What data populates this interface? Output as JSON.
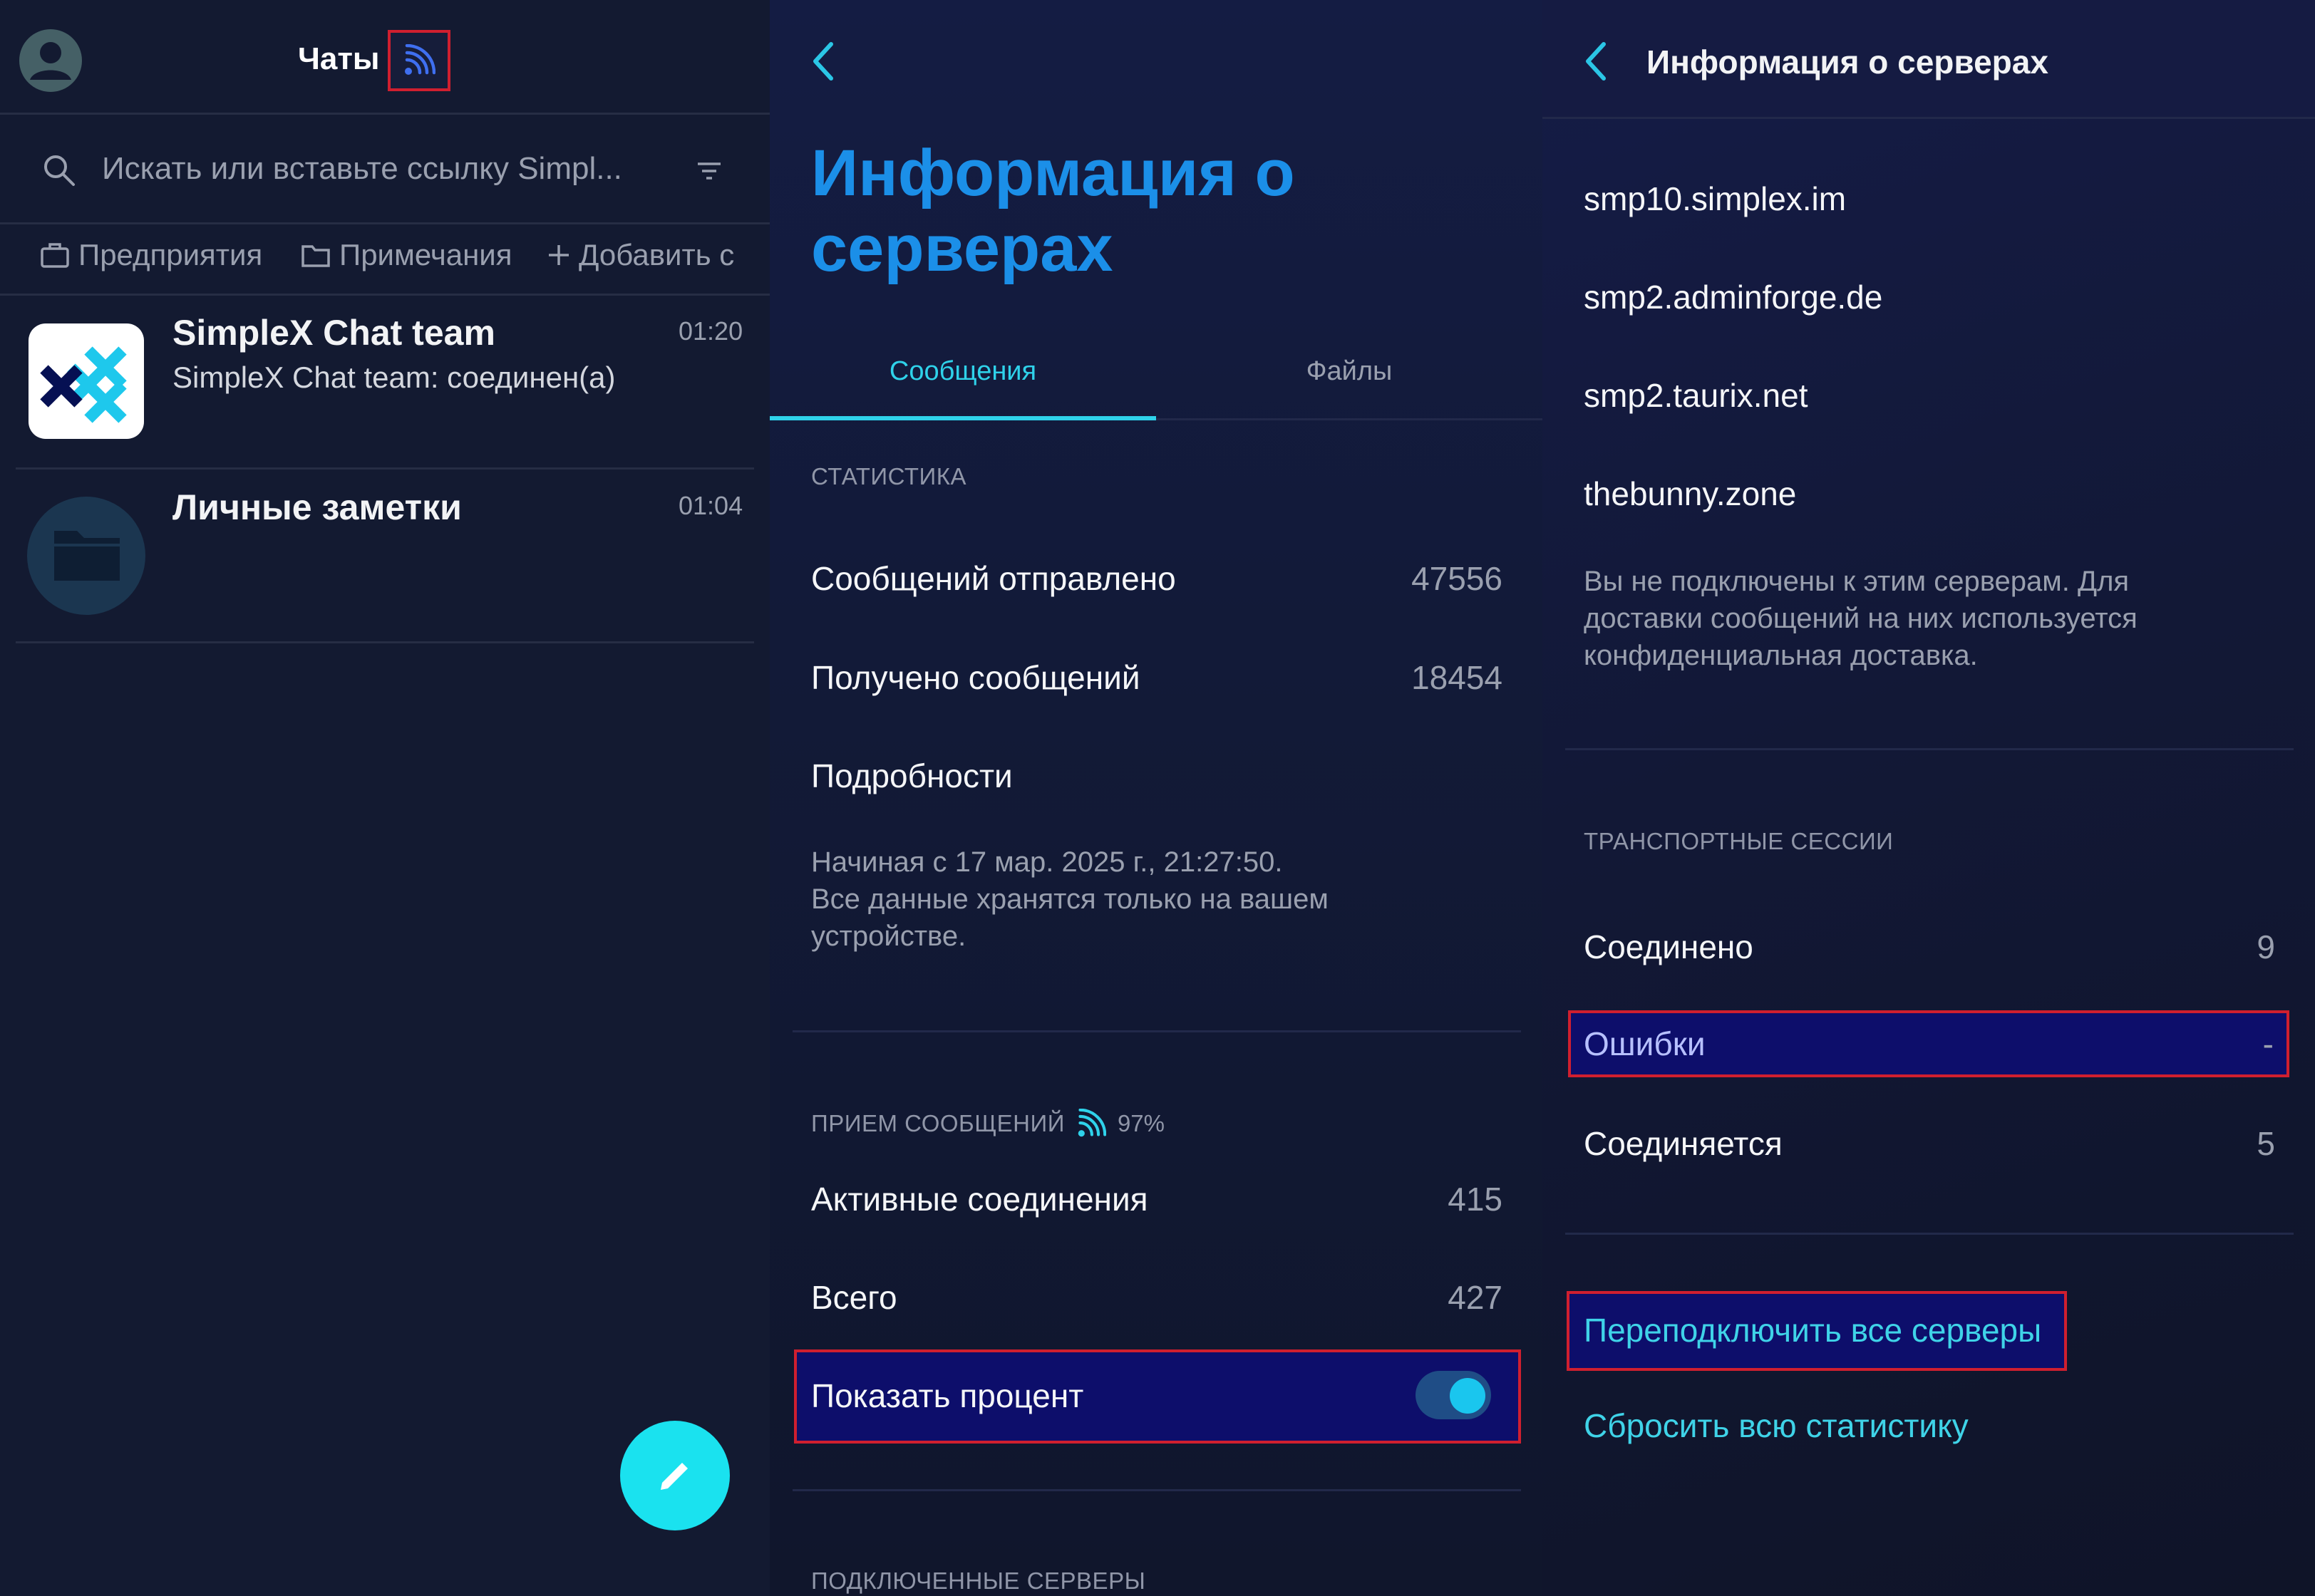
{
  "chats": {
    "title": "Чаты",
    "search_placeholder": "Искать или вставьте ссылку Simpl...",
    "filters": [
      "Предприятия",
      "Примечания",
      "Добавить с"
    ],
    "items": [
      {
        "name": "SimpleX Chat team",
        "preview": "SimpleX Chat team: соединен(а)",
        "time": "01:20"
      },
      {
        "name": "Личные заметки",
        "preview": "",
        "time": "01:04"
      }
    ]
  },
  "server_info": {
    "title": "Информация о серверах",
    "tabs": [
      "Сообщения",
      "Файлы"
    ],
    "stats_header": "СТАТИСТИКА",
    "sent_label": "Сообщений отправлено",
    "sent_value": "47556",
    "received_label": "Получено сообщений",
    "received_value": "18454",
    "details_label": "Подробности",
    "since_note": "Начиная с 17 мар. 2025 г., 21:27:50.\nВсе данные хранятся только на вашем устройстве.",
    "reception_header": "ПРИЕМ СООБЩЕНИЙ",
    "reception_percent": "97%",
    "active_label": "Активные соединения",
    "active_value": "415",
    "total_label": "Всего",
    "total_value": "427",
    "show_percent_label": "Показать процент",
    "show_percent_on": true,
    "connected_servers_header": "ПОДКЛЮЧЕННЫЕ СЕРВЕРЫ"
  },
  "server_info2": {
    "title": "Информация о серверах",
    "servers": [
      "smp10.simplex.im",
      "smp2.adminforge.de",
      "smp2.taurix.net",
      "thebunny.zone"
    ],
    "not_connected_note": "Вы не подключены к этим серверам. Для доставки сообщений на них используется конфиденциальная доставка.",
    "sessions_header": "ТРАНСПОРТНЫЕ СЕССИИ",
    "connected_label": "Соединено",
    "connected_value": "9",
    "errors_label": "Ошибки",
    "errors_value": "-",
    "connecting_label": "Соединяется",
    "connecting_value": "5",
    "reconnect_all": "Переподключить все серверы",
    "reset_stats": "Сбросить всю статистику"
  },
  "colors": {
    "accent": "#3fd3e8",
    "title_blue": "#1b8fe8",
    "highlight": "#d01f2f",
    "selected_bg": "#0d0e6b"
  }
}
